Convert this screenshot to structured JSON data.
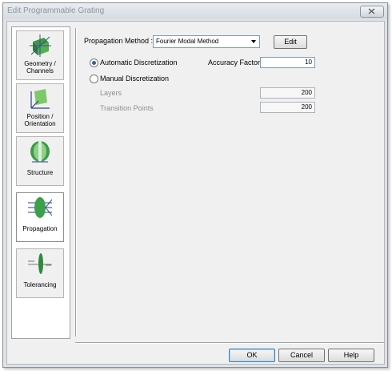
{
  "window": {
    "title": "Edit Programmable Grating"
  },
  "nav": {
    "items": [
      {
        "label_line1": "Geometry /",
        "label_line2": "Channels",
        "icon": "geometry-channels-icon"
      },
      {
        "label_line1": "Position /",
        "label_line2": "Orientation",
        "icon": "position-orientation-icon"
      },
      {
        "label_line1": "Structure",
        "label_line2": "",
        "icon": "structure-icon"
      },
      {
        "label_line1": "Propagation",
        "label_line2": "",
        "icon": "propagation-icon"
      },
      {
        "label_line1": "Tolerancing",
        "label_line2": "",
        "icon": "tolerancing-icon"
      }
    ],
    "active": "Propagation"
  },
  "main": {
    "propagation_method_label": "Propagation Method :",
    "propagation_method_value": "Fourier Modal Method",
    "edit_label": "Edit",
    "auto_disc_label": "Automatic Discretization",
    "auto_disc_selected": true,
    "accuracy_factor_label": "Accuracy Factor",
    "accuracy_factor_value": "10",
    "manual_disc_label": "Manual Discretization",
    "manual_disc_selected": false,
    "layers_label": "Layers",
    "layers_value": "200",
    "transition_points_label": "Transition Points",
    "transition_points_value": "200"
  },
  "footer": {
    "ok_label": "OK",
    "cancel_label": "Cancel",
    "help_label": "Help"
  }
}
